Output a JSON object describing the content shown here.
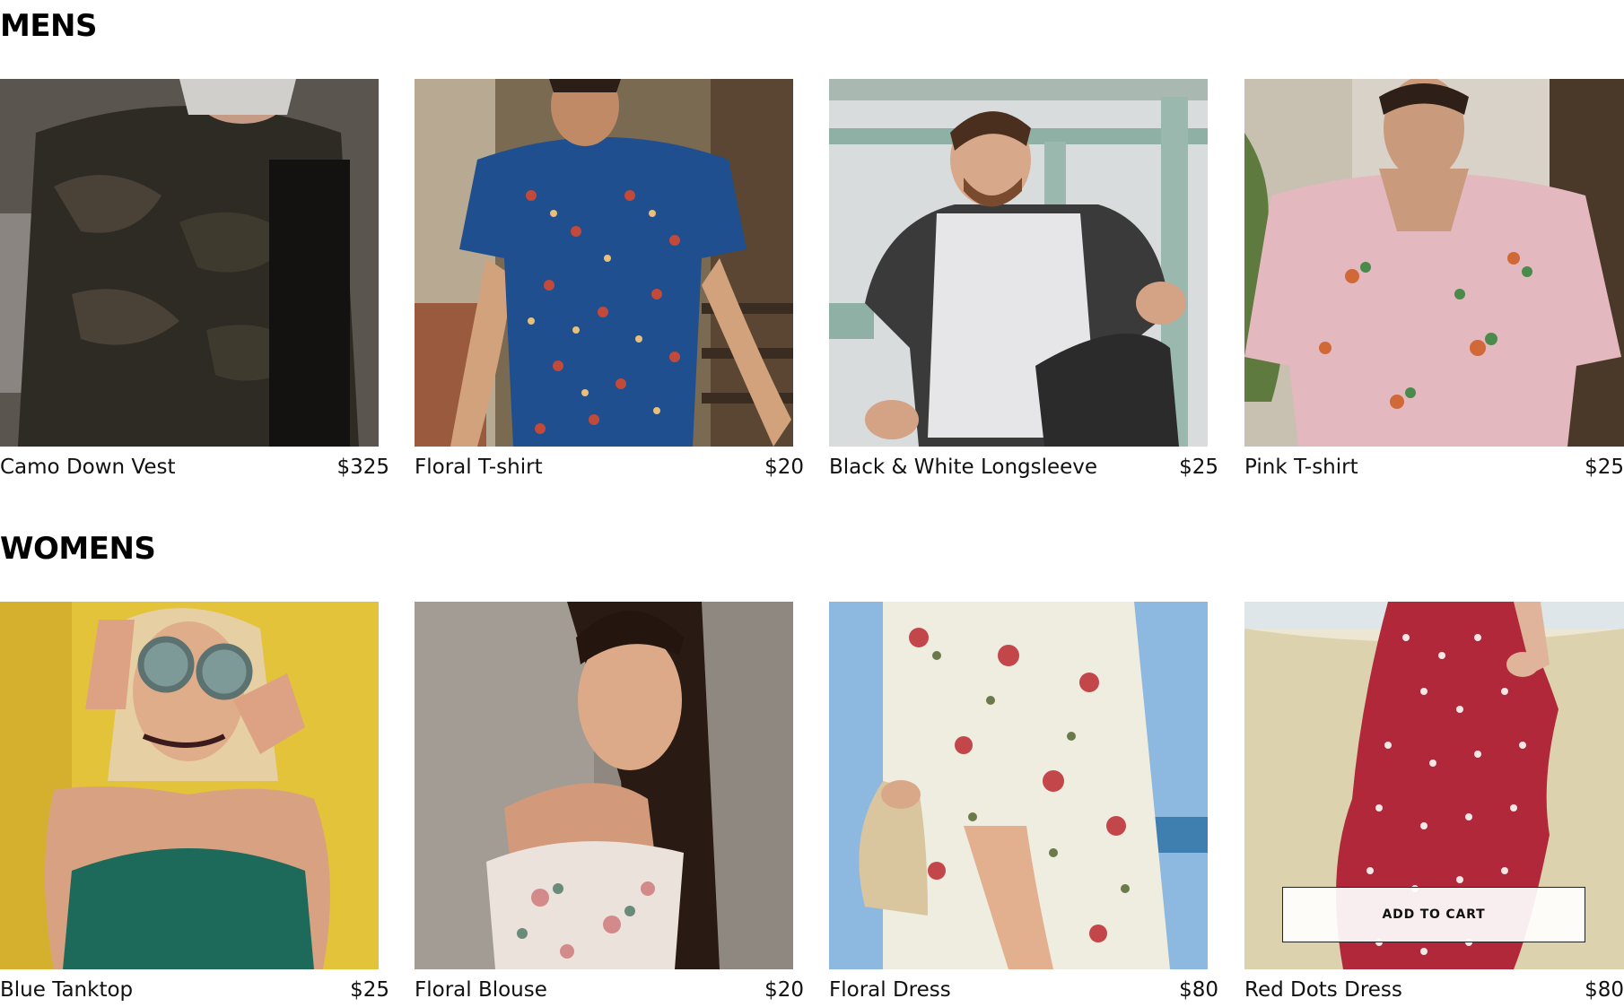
{
  "sections": {
    "mens": {
      "title": "MENS",
      "products": [
        {
          "name": "Camo Down Vest",
          "price": "$325"
        },
        {
          "name": "Floral T-shirt",
          "price": "$20"
        },
        {
          "name": "Black & White Longsleeve",
          "price": "$25"
        },
        {
          "name": "Pink T-shirt",
          "price": "$25"
        }
      ]
    },
    "womens": {
      "title": "WOMENS",
      "products": [
        {
          "name": "Blue Tanktop",
          "price": "$25"
        },
        {
          "name": "Floral Blouse",
          "price": "$20"
        },
        {
          "name": "Floral Dress",
          "price": "$80"
        },
        {
          "name": "Red Dots Dress",
          "price": "$80"
        }
      ]
    }
  },
  "hover_card": {
    "add_to_cart_label": "ADD TO CART"
  }
}
